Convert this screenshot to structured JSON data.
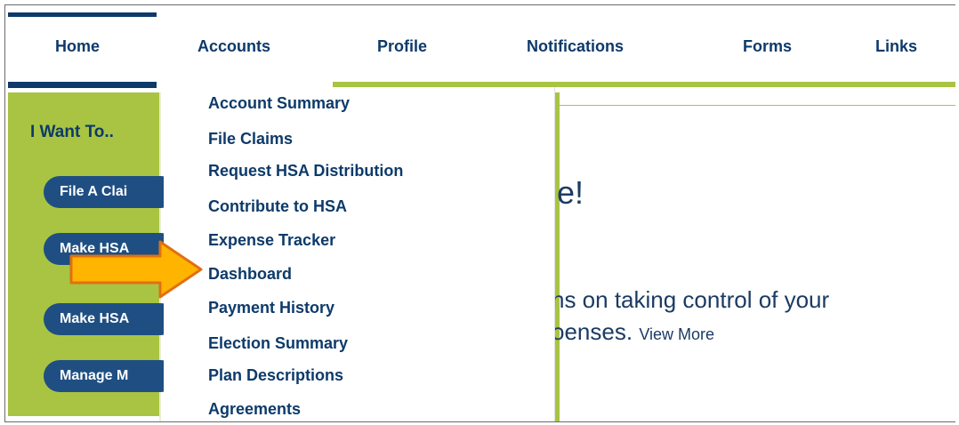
{
  "nav": {
    "tabs": [
      {
        "label": "Home"
      },
      {
        "label": "Accounts"
      },
      {
        "label": "Profile"
      },
      {
        "label": "Notifications"
      },
      {
        "label": "Forms"
      },
      {
        "label": "Links"
      }
    ]
  },
  "accounts_menu": {
    "items": [
      {
        "label": "Account Summary"
      },
      {
        "label": "File Claims"
      },
      {
        "label": "Request HSA Distribution"
      },
      {
        "label": "Contribute to HSA"
      },
      {
        "label": "Expense Tracker"
      },
      {
        "label": "Dashboard"
      },
      {
        "label": "Payment History"
      },
      {
        "label": "Election Summary"
      },
      {
        "label": "Plan Descriptions"
      },
      {
        "label": "Agreements"
      }
    ]
  },
  "sidebar": {
    "title": "I Want To..",
    "buttons": [
      {
        "label": "File A Clai"
      },
      {
        "label": "Make HSA"
      },
      {
        "label": "Make HSA"
      },
      {
        "label": "Manage M"
      }
    ]
  },
  "main": {
    "welcome_partial": "ne!",
    "intro_line1_partial": "ns on taking control of your",
    "intro_line2_partial": "oenses.",
    "view_more": "View More"
  },
  "colors": {
    "navy": "#0d3a6a",
    "green": "#a8c442",
    "pill_blue": "#1f4f82",
    "arrow_orange": "#f0a020"
  }
}
